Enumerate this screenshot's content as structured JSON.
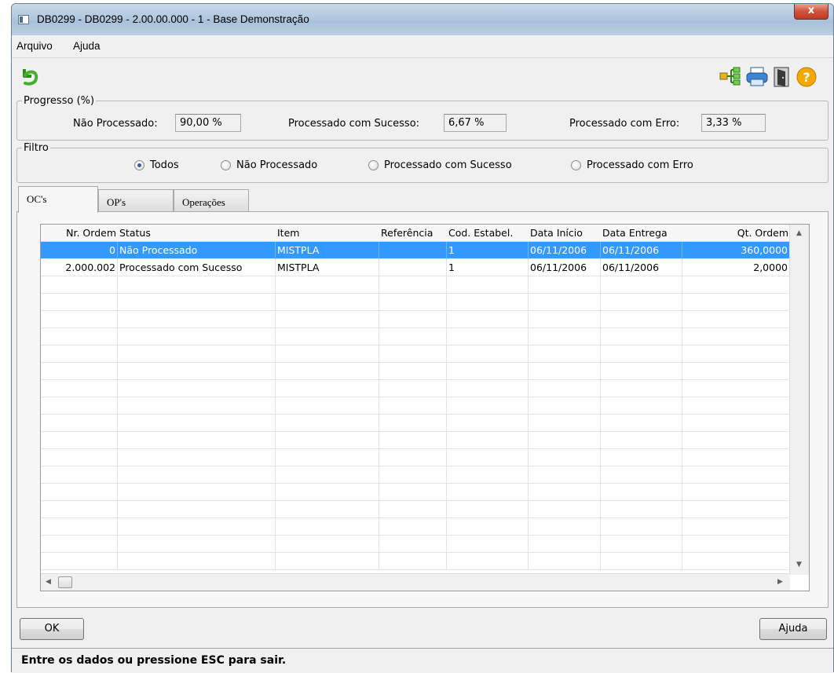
{
  "window": {
    "title": "DB0299 - DB0299 - 2.00.00.000 - 1 - Base Demonstração",
    "close_label": "x"
  },
  "menu": {
    "items": [
      "Arquivo",
      "Ajuda"
    ]
  },
  "toolbar": {
    "icons": [
      "undo-icon",
      "tree-icon",
      "print-icon",
      "exit-door-icon",
      "help-icon"
    ]
  },
  "progress": {
    "legend": "Progresso (%)",
    "nao_processado_label": "Não Processado:",
    "nao_processado_value": "90,00 %",
    "sucesso_label": "Processado com Sucesso:",
    "sucesso_value": "6,67 %",
    "erro_label": "Processado com Erro:",
    "erro_value": "3,33 %"
  },
  "filter": {
    "legend": "Filtro",
    "options": [
      "Todos",
      "Não Processado",
      "Processado com Sucesso",
      "Processado com Erro"
    ],
    "selected": "Todos"
  },
  "tabs": [
    "OC's",
    "OP's",
    "Operações"
  ],
  "active_tab": "OC's",
  "grid": {
    "columns": [
      "Nr. Ordem",
      "Status",
      "Item",
      "Referência",
      "Cod. Estabel.",
      "Data Início",
      "Data Entrega",
      "Qt. Ordem"
    ],
    "rows": [
      [
        "0",
        "Não Processado",
        "MISTPLA",
        "",
        "1",
        "06/11/2006",
        "06/11/2006",
        "360,0000"
      ],
      [
        "2.000.002",
        "Processado com Sucesso",
        "MISTPLA",
        "",
        "1",
        "06/11/2006",
        "06/11/2006",
        "2,0000"
      ]
    ],
    "selected_row": 0
  },
  "buttons": {
    "ok": "OK",
    "ajuda": "Ajuda"
  },
  "status": "Entre os dados ou pressione ESC para sair.",
  "colors": {
    "selection": "#3399ff",
    "help_icon": "#f5a800"
  }
}
